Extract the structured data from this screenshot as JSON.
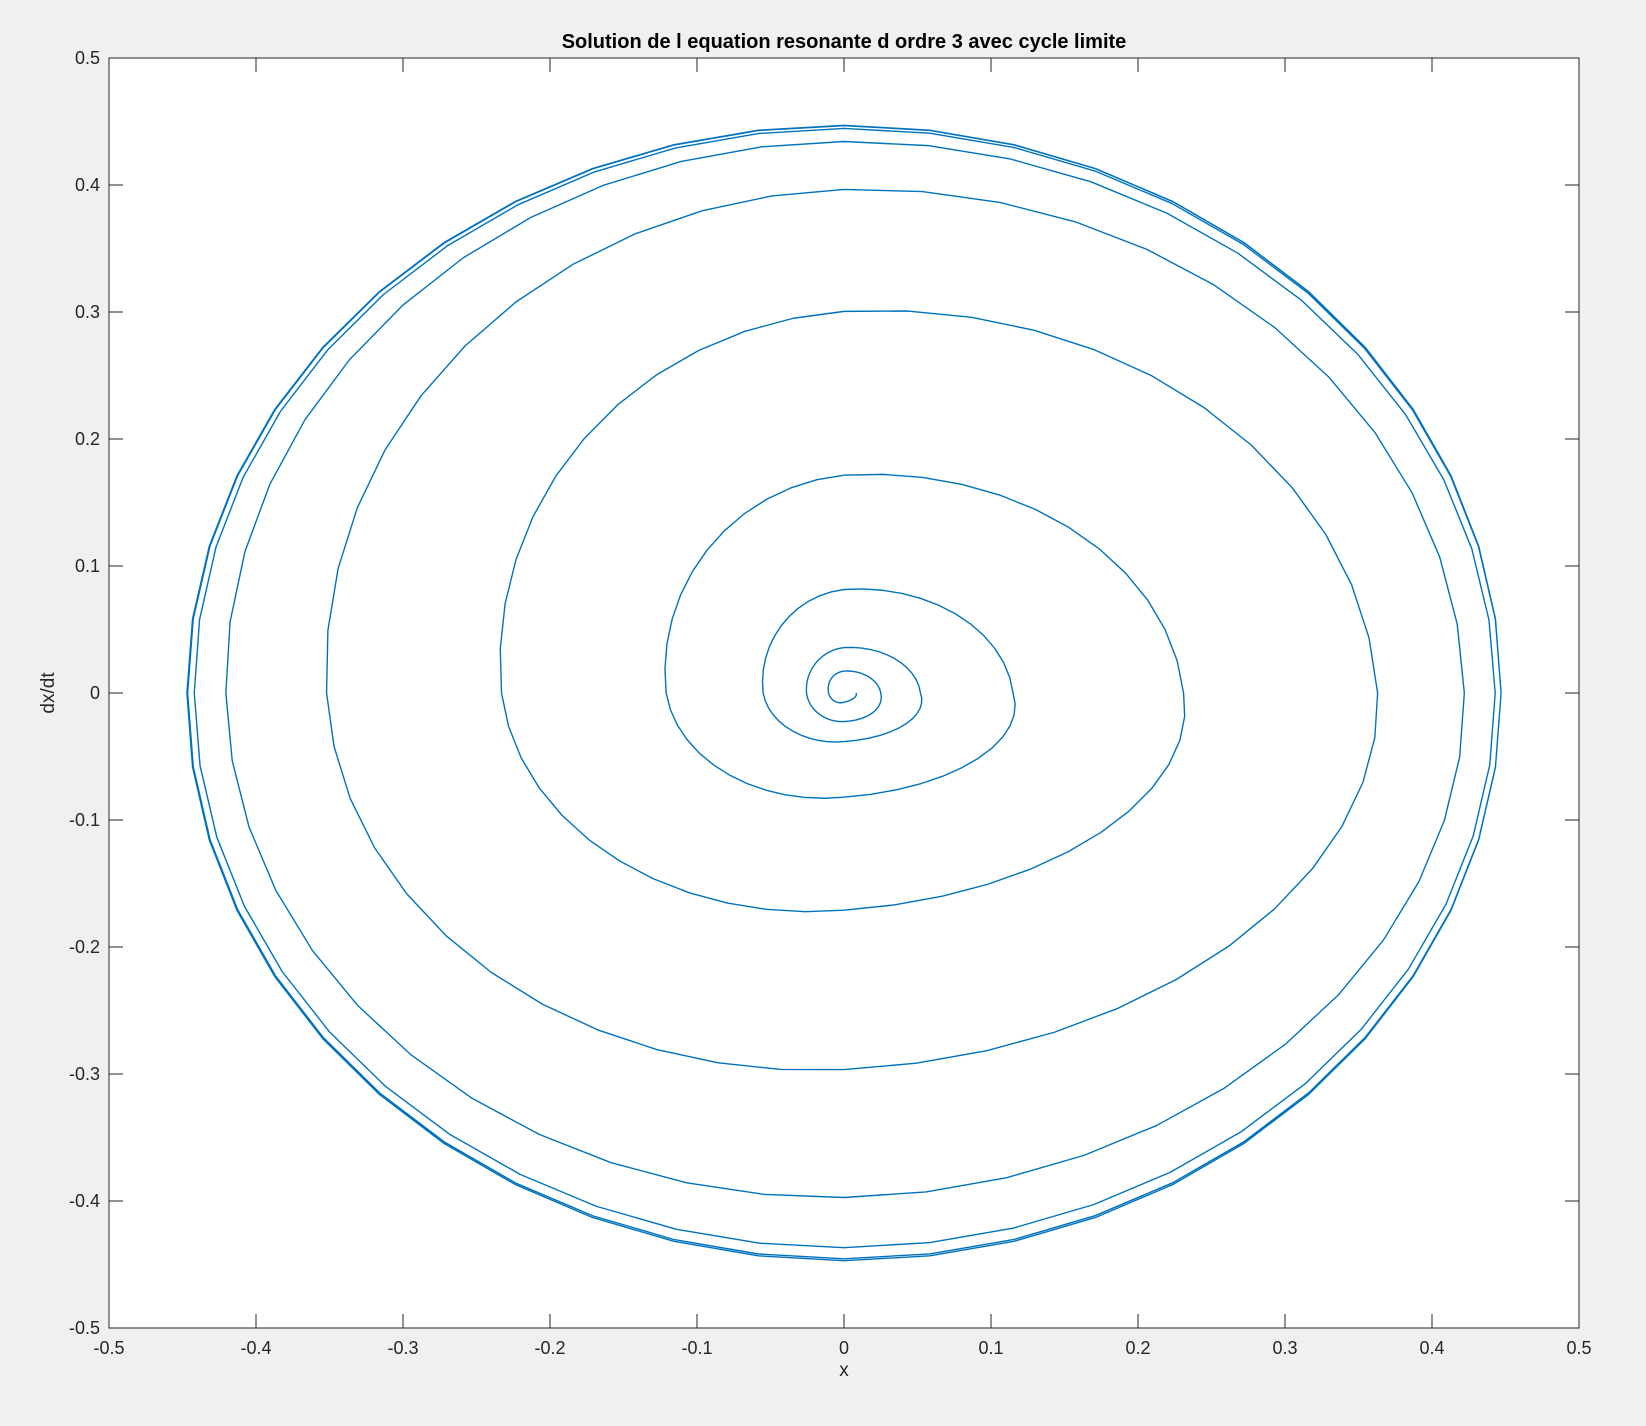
{
  "window": {
    "background": "#f0f0f0"
  },
  "chart_data": {
    "type": "line",
    "title": "Solution de l equation resonante d ordre 3 avec cycle limite",
    "xlabel": "x",
    "ylabel": "dx/dt",
    "xlim": [
      -0.5,
      0.5
    ],
    "ylim": [
      -0.5,
      0.5
    ],
    "xticks": [
      -0.5,
      -0.4,
      -0.3,
      -0.2,
      -0.1,
      0,
      0.1,
      0.2,
      0.3,
      0.4,
      0.5
    ],
    "yticks": [
      -0.5,
      -0.4,
      -0.3,
      -0.2,
      -0.1,
      0,
      0.1,
      0.2,
      0.3,
      0.4,
      0.5
    ],
    "xtick_labels": [
      "-0.5",
      "-0.4",
      "-0.3",
      "-0.2",
      "-0.1",
      "0",
      "0.1",
      "0.2",
      "0.3",
      "0.4",
      "0.5"
    ],
    "ytick_labels": [
      "-0.5",
      "-0.4",
      "-0.3",
      "-0.2",
      "-0.1",
      "0",
      "0.1",
      "0.2",
      "0.3",
      "0.4",
      "0.5"
    ],
    "grid": false,
    "series": [
      {
        "color": "#0072bd",
        "shape": "spiral converging to a limit cycle",
        "start": [
          0.001,
          0.001
        ],
        "limit_cycle_amplitude": 0.447,
        "turn_extents": [
          {
            "x": [
              -0.003,
              0.008
            ],
            "y": [
              -0.003,
              0.009
            ]
          },
          {
            "x": [
              -0.018,
              0.025
            ],
            "y": [
              -0.02,
              0.02
            ]
          },
          {
            "x": [
              -0.033,
              0.052
            ],
            "y": [
              -0.03,
              0.041
            ]
          },
          {
            "x": [
              -0.077,
              0.115
            ],
            "y": [
              -0.063,
              0.095
            ]
          },
          {
            "x": [
              -0.165,
              0.231
            ],
            "y": [
              -0.139,
              0.197
            ]
          },
          {
            "x": [
              -0.301,
              0.363
            ],
            "y": [
              -0.267,
              0.335
            ]
          },
          {
            "x": [
              -0.403,
              0.422
            ],
            "y": [
              -0.385,
              0.417
            ]
          },
          {
            "x": [
              -0.438,
              0.443
            ],
            "y": [
              -0.434,
              0.44
            ]
          },
          {
            "x": [
              -0.446,
              0.447
            ],
            "y": [
              -0.445,
              0.446
            ]
          },
          {
            "x": [
              -0.447,
              0.447
            ],
            "y": [
              -0.447,
              0.447
            ]
          }
        ]
      }
    ]
  }
}
